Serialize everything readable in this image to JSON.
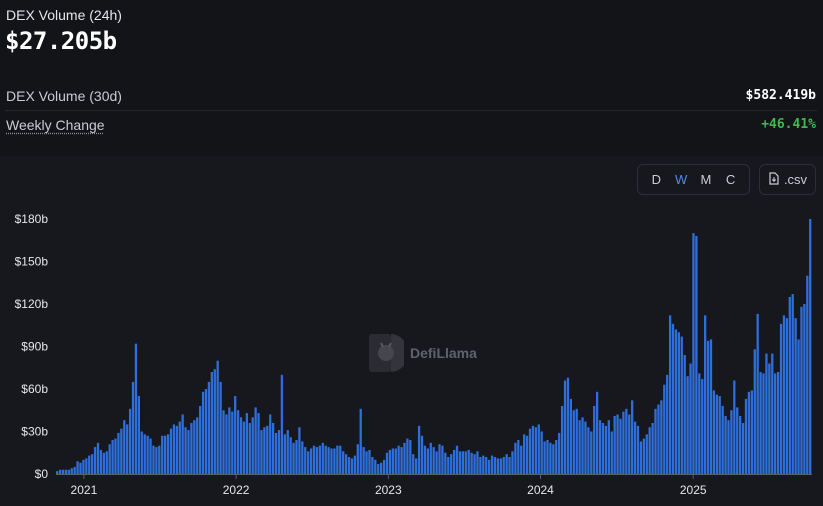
{
  "stats": {
    "volume_24h_label": "DEX Volume (24h)",
    "volume_24h_value": "$27.205b",
    "volume_30d_label": "DEX Volume (30d)",
    "volume_30d_value": "$582.419b",
    "weekly_change_label": "Weekly Change",
    "weekly_change_value": "+46.41%"
  },
  "controls": {
    "intervals": [
      "D",
      "W",
      "M",
      "C"
    ],
    "active_interval": "W",
    "csv_label": ".csv"
  },
  "watermark": "DefiLlama",
  "colors": {
    "bar": "#2f6fdb",
    "positive": "#3fb950",
    "active": "#4d8bf5",
    "background": "#131418"
  },
  "chart_data": {
    "type": "bar",
    "title": "",
    "xlabel": "",
    "ylabel": "",
    "x_start": "2020-10-26",
    "x_interval": "weekly",
    "ylim": [
      0,
      190
    ],
    "y_unit": "billion USD",
    "y_ticks": [
      "$0",
      "$30b",
      "$60b",
      "$90b",
      "$120b",
      "$150b",
      "$180b"
    ],
    "x_ticks": [
      "2021",
      "2022",
      "2023",
      "2024",
      "2025"
    ],
    "grid": false,
    "values": [
      2,
      3,
      3,
      3,
      3,
      4,
      5,
      9,
      8,
      10,
      11,
      13,
      14,
      19,
      22,
      17,
      15,
      16,
      21,
      24,
      25,
      29,
      32,
      38,
      35,
      46,
      65,
      92,
      55,
      30,
      28,
      27,
      25,
      20,
      19,
      20,
      27,
      27,
      28,
      32,
      35,
      34,
      37,
      42,
      33,
      31,
      36,
      38,
      40,
      48,
      58,
      60,
      65,
      72,
      74,
      80,
      65,
      45,
      42,
      47,
      44,
      55,
      45,
      40,
      37,
      43,
      36,
      40,
      47,
      43,
      31,
      33,
      34,
      42,
      36,
      29,
      31,
      70,
      28,
      31,
      26,
      22,
      24,
      33,
      23,
      19,
      16,
      18,
      20,
      19,
      20,
      22,
      20,
      19,
      18,
      18,
      20,
      20,
      16,
      14,
      12,
      11,
      13,
      21,
      46,
      19,
      16,
      17,
      12,
      10,
      7,
      8,
      10,
      15,
      17,
      18,
      18,
      20,
      19,
      22,
      25,
      24,
      14,
      11,
      34,
      27,
      20,
      18,
      22,
      19,
      16,
      21,
      20,
      15,
      12,
      14,
      17,
      20,
      16,
      16,
      16,
      17,
      15,
      14,
      16,
      12,
      13,
      12,
      10,
      13,
      12,
      11,
      11,
      12,
      14,
      12,
      16,
      22,
      24,
      20,
      28,
      27,
      32,
      34,
      33,
      35,
      30,
      23,
      24,
      22,
      21,
      24,
      29,
      48,
      66,
      68,
      53,
      45,
      46,
      38,
      40,
      37,
      33,
      30,
      48,
      58,
      38,
      36,
      34,
      38,
      30,
      41,
      42,
      39,
      44,
      46,
      42,
      52,
      37,
      34,
      23,
      25,
      28,
      33,
      36,
      46,
      49,
      52,
      63,
      70,
      112,
      106,
      102,
      100,
      97,
      84,
      69,
      78,
      170,
      168,
      71,
      67,
      112,
      94,
      95,
      59,
      56,
      55,
      48,
      41,
      38,
      45,
      66,
      47,
      41,
      36,
      53,
      58,
      59,
      88,
      113,
      72,
      71,
      85,
      78,
      85,
      71,
      72,
      106,
      112,
      110,
      125,
      127,
      110,
      95,
      118,
      120,
      140,
      180
    ]
  }
}
